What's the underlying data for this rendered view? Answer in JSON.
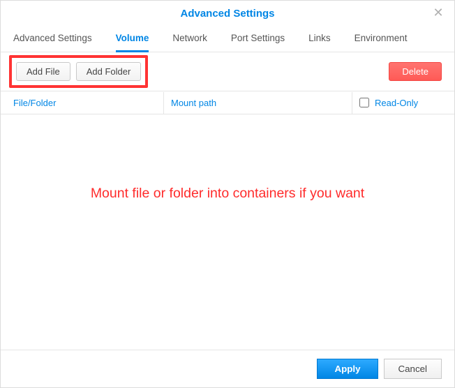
{
  "title": "Advanced Settings",
  "tabs": [
    {
      "label": "Advanced Settings",
      "active": false
    },
    {
      "label": "Volume",
      "active": true
    },
    {
      "label": "Network",
      "active": false
    },
    {
      "label": "Port Settings",
      "active": false
    },
    {
      "label": "Links",
      "active": false
    },
    {
      "label": "Environment",
      "active": false
    }
  ],
  "toolbar": {
    "add_file": "Add File",
    "add_folder": "Add Folder",
    "delete": "Delete"
  },
  "table": {
    "col_file": "File/Folder",
    "col_mount": "Mount path",
    "col_readonly": "Read-Only"
  },
  "annotation": "Mount file or folder into containers if you want",
  "footer": {
    "apply": "Apply",
    "cancel": "Cancel"
  }
}
